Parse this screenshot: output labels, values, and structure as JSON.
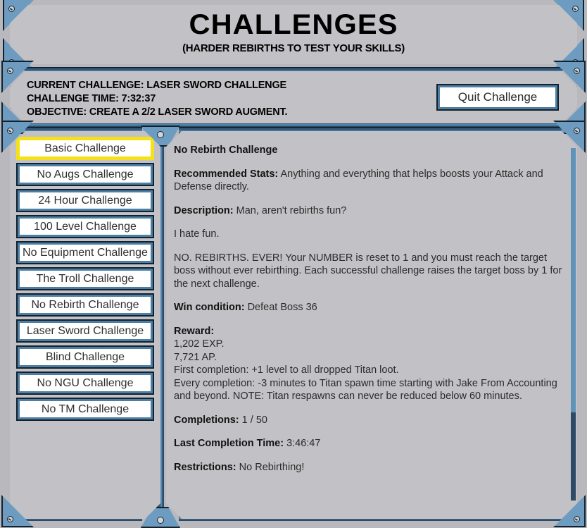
{
  "header": {
    "title": "CHALLENGES",
    "subtitle": "(HARDER REBIRTHS TO TEST YOUR SKILLS)"
  },
  "info": {
    "current_challenge": "CURRENT CHALLENGE: LASER SWORD CHALLENGE",
    "challenge_time": "CHALLENGE TIME: 7:32:37",
    "objective": "OBJECTIVE: CREATE A 2/2 LASER SWORD AUGMENT.",
    "quit_label": "Quit Challenge"
  },
  "sidebar": {
    "items": [
      {
        "label": "Basic Challenge",
        "selected": true
      },
      {
        "label": "No Augs Challenge",
        "selected": false
      },
      {
        "label": "24 Hour Challenge",
        "selected": false
      },
      {
        "label": "100 Level Challenge",
        "selected": false
      },
      {
        "label": "No Equipment Challenge",
        "selected": false
      },
      {
        "label": "The Troll Challenge",
        "selected": false
      },
      {
        "label": "No Rebirth Challenge",
        "selected": false
      },
      {
        "label": "Laser Sword Challenge",
        "selected": false
      },
      {
        "label": "Blind Challenge",
        "selected": false
      },
      {
        "label": "No NGU Challenge",
        "selected": false
      },
      {
        "label": "No TM Challenge",
        "selected": false
      }
    ]
  },
  "content": {
    "title": "No Rebirth Challenge",
    "recommended_stats_label": "Recommended Stats:",
    "recommended_stats_value": "Anything and everything that helps boosts your Attack and Defense directly.",
    "description_label": "Description:",
    "description_value": "Man, aren't rebirths fun?",
    "description_line2": "I hate fun.",
    "description_line3": "NO. REBIRTHS. EVER! Your NUMBER is reset to 1 and you must reach the target boss without ever rebirthing. Each successful challenge raises the target boss by 1 for the next challenge.",
    "win_condition_label": "Win condition:",
    "win_condition_value": "Defeat Boss 36",
    "reward_label": "Reward:",
    "reward_lines": [
      "1,202 EXP.",
      "7,721 AP.",
      "First completion: +1 level to all dropped Titan loot.",
      "Every completion: -3 minutes to Titan spawn time starting with Jake From Accounting and beyond. NOTE: Titan respawns can never be reduced below 60 minutes."
    ],
    "completions_label": "Completions:",
    "completions_value": "1 / 50",
    "last_completion_label": "Last Completion Time:",
    "last_completion_value": "3:46:47",
    "restrictions_label": "Restrictions:",
    "restrictions_value": "No Rebirthing!"
  },
  "colors": {
    "panel_bg": "#c2c2c6",
    "frame_dark": "#0d1a26",
    "frame_mid": "#35597a",
    "frame_light": "#4f86ad",
    "plate": "#6d9cc0",
    "selected_border": "#f5e11a"
  }
}
